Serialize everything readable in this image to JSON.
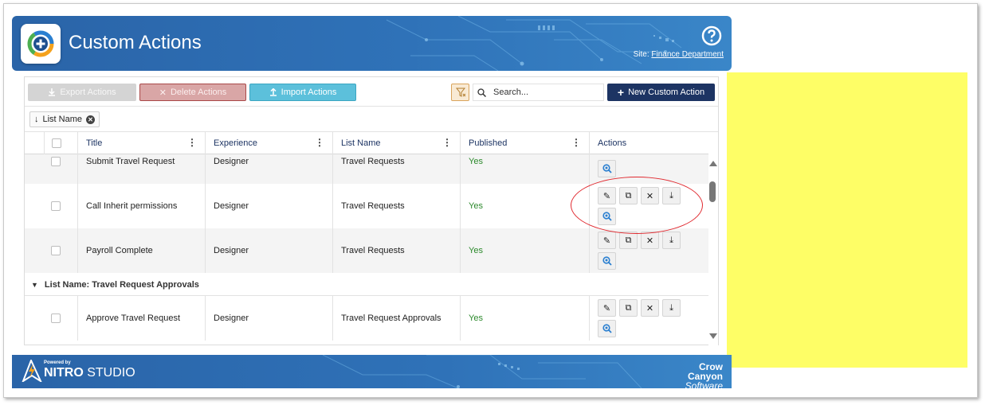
{
  "header": {
    "title": "Custom Actions",
    "site_label": "Site:",
    "site_link": "Finance Department"
  },
  "toolbar": {
    "export_label": "Export Actions",
    "delete_label": "Delete Actions",
    "import_label": "Import Actions",
    "search_placeholder": "Search...",
    "new_label": "New Custom Action"
  },
  "grouping": {
    "chip_label": "List Name"
  },
  "columns": [
    "Title",
    "Experience",
    "List Name",
    "Published",
    "Actions"
  ],
  "rows": [
    {
      "title": "Submit Travel Request",
      "experience": "Designer",
      "list_name": "Travel Requests",
      "published": "Yes"
    },
    {
      "title": "Call Inherit permissions",
      "experience": "Designer",
      "list_name": "Travel Requests",
      "published": "Yes"
    },
    {
      "title": "Payroll Complete",
      "experience": "Designer",
      "list_name": "Travel Requests",
      "published": "Yes"
    }
  ],
  "group2": {
    "label": "List Name: Travel Request Approvals",
    "rows": [
      {
        "title": "Approve Travel Request",
        "experience": "Designer",
        "list_name": "Travel Request Approvals",
        "published": "Yes"
      }
    ]
  },
  "footer": {
    "powered_by": "Powered by",
    "nitro_bold": "NITRO",
    "nitro_rest": " STUDIO",
    "brand_top": "Crow Canyon",
    "brand_bottom": "Software"
  },
  "colors": {
    "header_blue": "#2f72b8",
    "new_button": "#1d3463",
    "published_yes": "#2d8a2d",
    "annotation": "#e0282e",
    "highlight_yellow": "#fefe66"
  }
}
